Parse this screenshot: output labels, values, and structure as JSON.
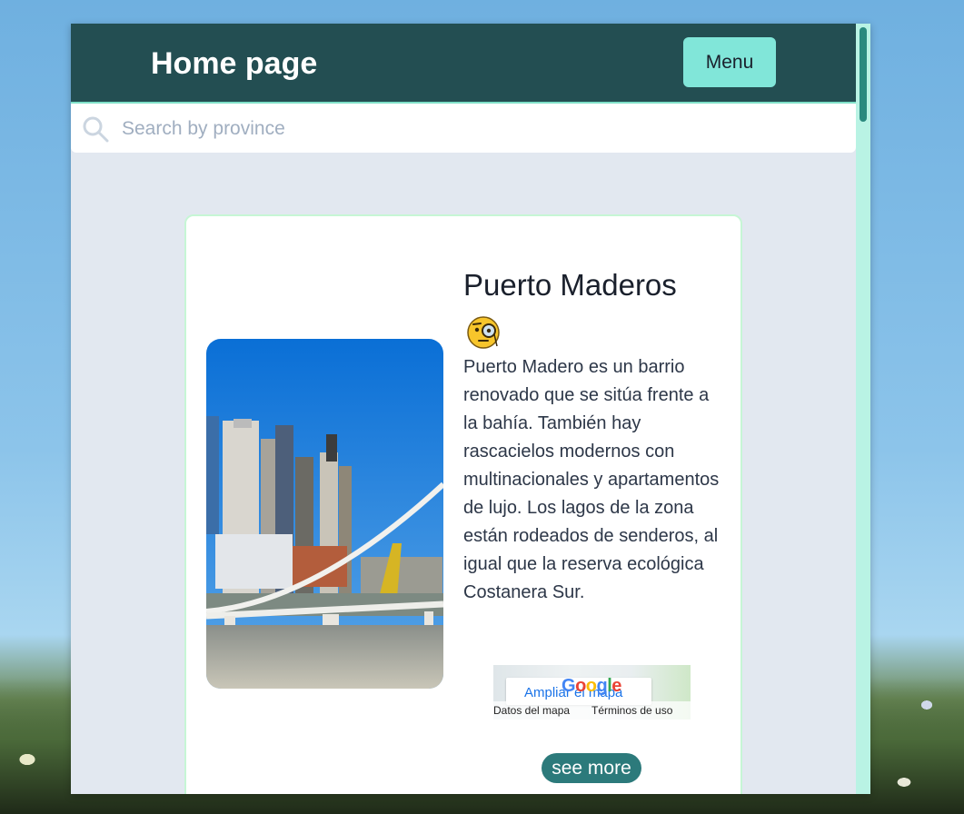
{
  "header": {
    "title": "Home page",
    "menu_label": "Menu"
  },
  "search": {
    "placeholder": "Search by province",
    "value": ""
  },
  "card": {
    "title": "Puerto Maderos",
    "emoji": "face-with-monocle",
    "description": "Puerto Madero es un barrio renovado que se sitúa frente a la bahía. También hay rascacielos modernos con multinacionales y apartamentos de lujo. Los lagos de la zona están rodeados de senderos, al igual que la reserva ecológica Costanera Sur.",
    "map": {
      "link_label": "Ampliar el mapa",
      "logo": "Google",
      "map_data_label": "Datos del mapa",
      "terms_label": "Términos de uso"
    },
    "see_more_label": "see more"
  },
  "colors": {
    "header_bg": "#234e52",
    "menu_button": "#81e6d9",
    "page_bg": "#e2e8f0",
    "card_border": "#c6f6d5",
    "see_more_button": "#2c7a7b"
  }
}
